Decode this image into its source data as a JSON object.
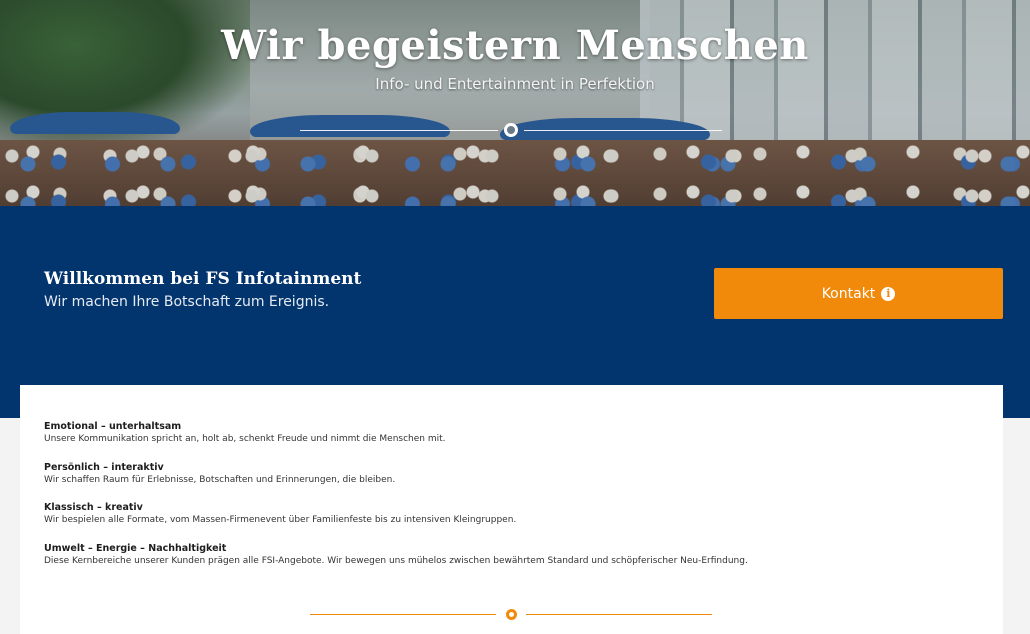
{
  "hero": {
    "title": "Wir begeistern Menschen",
    "subtitle": "Info- und Entertainment in Perfektion",
    "divider_icon": "globe-icon"
  },
  "banner": {
    "welcome_title": "Willkommen bei FS Infotainment",
    "welcome_subtitle": "Wir machen Ihre Botschaft zum Ereignis.",
    "contact_button": "Kontakt",
    "contact_icon": "info-icon",
    "background_color": "#02346e",
    "accent_color": "#f1890a"
  },
  "features": [
    {
      "title": "Emotional – unterhaltsam",
      "text": "Unsere Kommunikation spricht an, holt ab, schenkt Freude und nimmt die Menschen mit."
    },
    {
      "title": "Persönlich – interaktiv",
      "text": "Wir schaffen Raum für Erlebnisse, Botschaften und Erinnerungen, die bleiben."
    },
    {
      "title": "Klassisch – kreativ",
      "text": "Wir bespielen alle Formate, vom Massen-Firmenevent über Familienfeste bis zu intensiven Kleingruppen."
    },
    {
      "title": "Umwelt – Energie – Nachhaltigkeit",
      "text": "Diese Kernbereiche unserer Kunden prägen alle FSI-Angebote. Wir bewegen uns mühelos zwischen bewährtem Standard und schöpferischer Neu-Erfindung."
    }
  ],
  "footer": {
    "divider_icon": "globe-icon"
  }
}
